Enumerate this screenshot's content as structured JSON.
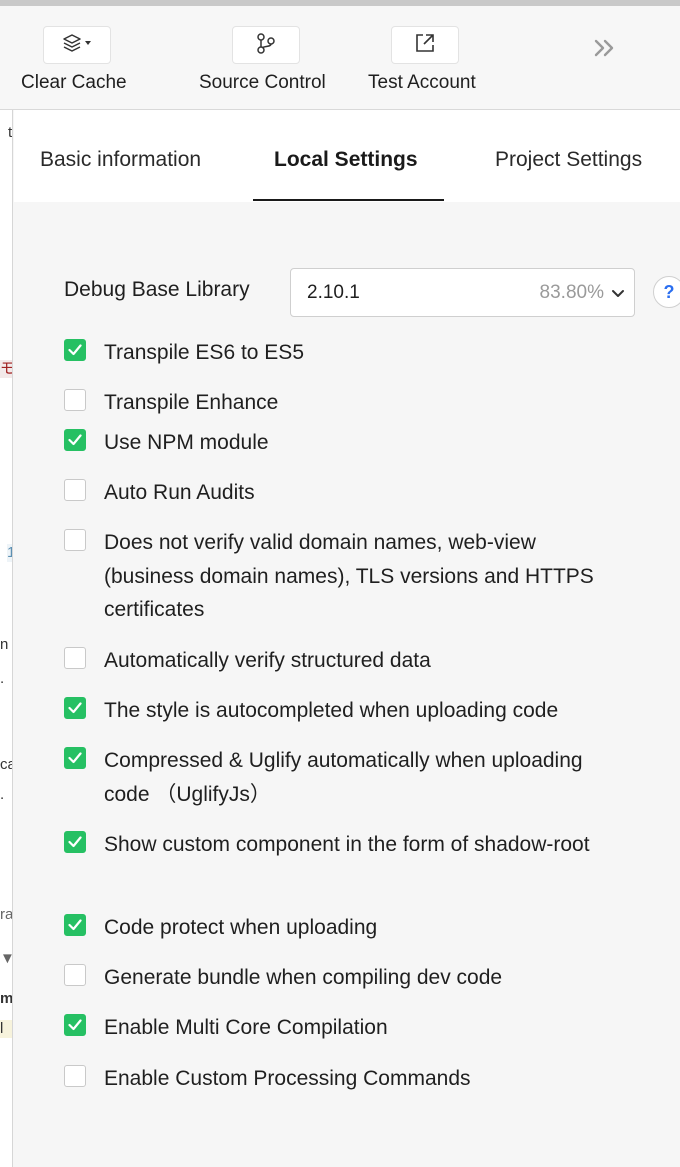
{
  "toolbar": {
    "clear_cache": {
      "label": "Clear Cache",
      "icon": "layers-icon"
    },
    "source_control": {
      "label": "Source Control",
      "icon": "git-branch-icon"
    },
    "test_account": {
      "label": "Test Account",
      "icon": "external-link-icon"
    },
    "expand_icon": "double-chevron-right-icon"
  },
  "left_fragments": [
    "t",
    "モ",
    "1",
    "n",
    ".",
    "ca",
    ".",
    "ra",
    "▼",
    "mp",
    "l"
  ],
  "tabs": [
    {
      "label": "Basic information",
      "active": false
    },
    {
      "label": "Local Settings",
      "active": true
    },
    {
      "label": "Project Settings",
      "active": false
    }
  ],
  "debug_base_library": {
    "label": "Debug Base Library",
    "version": "2.10.1",
    "percentage": "83.80%",
    "help": "?"
  },
  "options": [
    {
      "label": "Transpile ES6 to ES5",
      "checked": true
    },
    {
      "label": "Transpile Enhance",
      "checked": false
    },
    {
      "label": "Use NPM module",
      "checked": true
    },
    {
      "label": "Auto Run Audits",
      "checked": false
    },
    {
      "label": "Does not verify valid domain names, web-view (business domain names), TLS versions and HTTPS certificates",
      "checked": false
    },
    {
      "label": "Automatically verify structured data",
      "checked": false
    },
    {
      "label": "The style is autocompleted when uploading code",
      "checked": true
    },
    {
      "label": "Compressed & Uglify automatically when uploading code （UglifyJs）",
      "checked": true
    },
    {
      "label": "Show custom component in the form of shadow-root",
      "checked": true
    },
    {
      "label": "Code protect when uploading",
      "checked": true
    },
    {
      "label": "Generate bundle when compiling dev code",
      "checked": false
    },
    {
      "label": "Enable Multi Core Compilation",
      "checked": true
    },
    {
      "label": "Enable Custom Processing Commands",
      "checked": false
    }
  ],
  "colors": {
    "checked": "#26c063",
    "help": "#2b6ff0"
  }
}
